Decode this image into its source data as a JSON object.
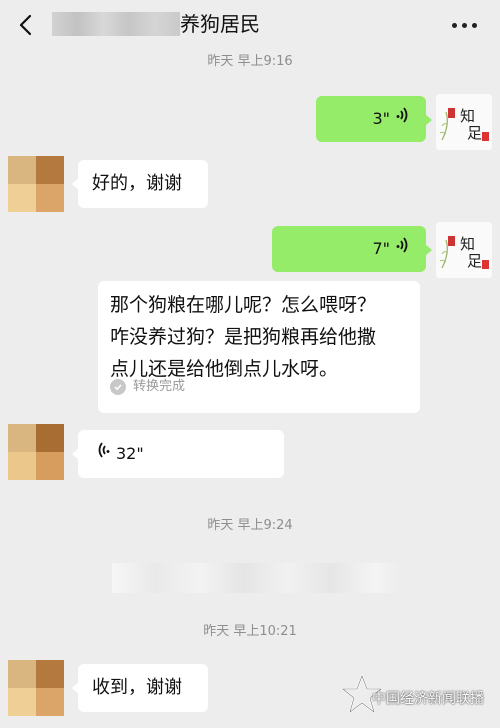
{
  "header": {
    "title_suffix": "养狗居民",
    "back_icon": "back-arrow-icon",
    "more_icon": "more-dots-icon"
  },
  "messages": {
    "ts1": "昨天 早上9:16",
    "voice_out_1": "3\"",
    "text_in_1": "好的，谢谢",
    "voice_out_2": "7\"",
    "transcript_lines": [
      "那个狗粮在哪儿呢？怎么喂呀？",
      "咋没养过狗？是把狗粮再给他撒",
      "点儿还是给他倒点儿水呀。"
    ],
    "convert_status": "转换完成",
    "voice_in_1": "32\"",
    "ts2": "昨天 早上9:24",
    "ts3": "昨天 早上10:21",
    "text_in_2": "收到，谢谢"
  },
  "self_avatar": {
    "text_big": "知足",
    "stamp": "知足"
  },
  "watermark": {
    "text": "中国经济新闻联播"
  },
  "colors": {
    "background": "#ededed",
    "outgoing_bubble": "#95ec69",
    "incoming_bubble": "#ffffff",
    "timestamp": "#8e8e8e"
  }
}
